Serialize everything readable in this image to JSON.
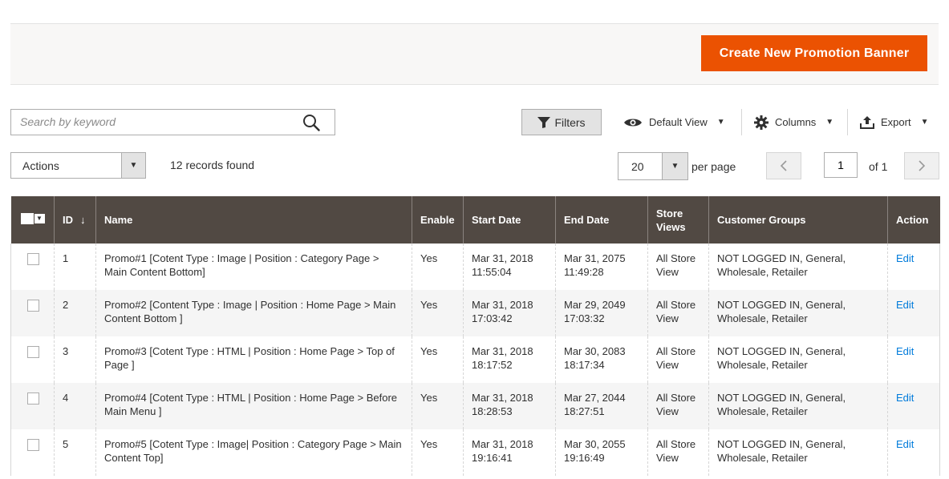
{
  "header": {
    "create_button_label": "Create New Promotion Banner"
  },
  "toolbar": {
    "search_placeholder": "Search by keyword",
    "filters_label": "Filters",
    "default_view_label": "Default View",
    "columns_label": "Columns",
    "export_label": "Export"
  },
  "grid_controls": {
    "actions_label": "Actions",
    "records_found": "12 records found",
    "per_page_value": "20",
    "per_page_label": "per page",
    "current_page": "1",
    "page_of": "of 1"
  },
  "table": {
    "columns": [
      "ID",
      "Name",
      "Enable",
      "Start Date",
      "End Date",
      "Store Views",
      "Customer Groups",
      "Action"
    ],
    "sort_indicator": "↓",
    "rows": [
      {
        "id": "1",
        "name": "Promo#1 [Cotent Type : Image | Position : Category Page > Main Content Bottom]",
        "enable": "Yes",
        "start_date": "Mar 31, 2018",
        "start_time": "11:55:04",
        "end_date": "Mar 31, 2075",
        "end_time": "11:49:28",
        "store": "All Store View",
        "groups": "NOT LOGGED IN, General, Wholesale, Retailer",
        "action": "Edit"
      },
      {
        "id": "2",
        "name": "Promo#2 [Content Type : Image | Position : Home Page > Main Content Bottom ]",
        "enable": "Yes",
        "start_date": "Mar 31, 2018",
        "start_time": "17:03:42",
        "end_date": "Mar 29, 2049",
        "end_time": "17:03:32",
        "store": "All Store View",
        "groups": "NOT LOGGED IN, General, Wholesale, Retailer",
        "action": "Edit"
      },
      {
        "id": "3",
        "name": "Promo#3 [Cotent Type : HTML | Position : Home Page > Top of Page ]",
        "enable": "Yes",
        "start_date": "Mar 31, 2018",
        "start_time": "18:17:52",
        "end_date": "Mar 30, 2083",
        "end_time": "18:17:34",
        "store": "All Store View",
        "groups": "NOT LOGGED IN, General, Wholesale, Retailer",
        "action": "Edit"
      },
      {
        "id": "4",
        "name": "Promo#4 [Cotent Type : HTML | Position : Home Page > Before Main Menu ]",
        "enable": "Yes",
        "start_date": "Mar 31, 2018",
        "start_time": "18:28:53",
        "end_date": "Mar 27, 2044",
        "end_time": "18:27:51",
        "store": "All Store View",
        "groups": "NOT LOGGED IN, General, Wholesale, Retailer",
        "action": "Edit"
      },
      {
        "id": "5",
        "name": "Promo#5 [Cotent Type : Image| Position : Category Page > Main Content Top]",
        "enable": "Yes",
        "start_date": "Mar 31, 2018",
        "start_time": "19:16:41",
        "end_date": "Mar 30, 2055",
        "end_time": "19:16:49",
        "store": "All Store View",
        "groups": "NOT LOGGED IN, General, Wholesale, Retailer",
        "action": "Edit"
      }
    ]
  },
  "colors": {
    "primary_button": "#eb5202",
    "table_header": "#514943",
    "link": "#007bdb"
  },
  "icons": {
    "search": "search-icon",
    "filter": "filter-icon",
    "view": "eye-icon",
    "columns": "gear-icon",
    "export": "export-icon"
  }
}
